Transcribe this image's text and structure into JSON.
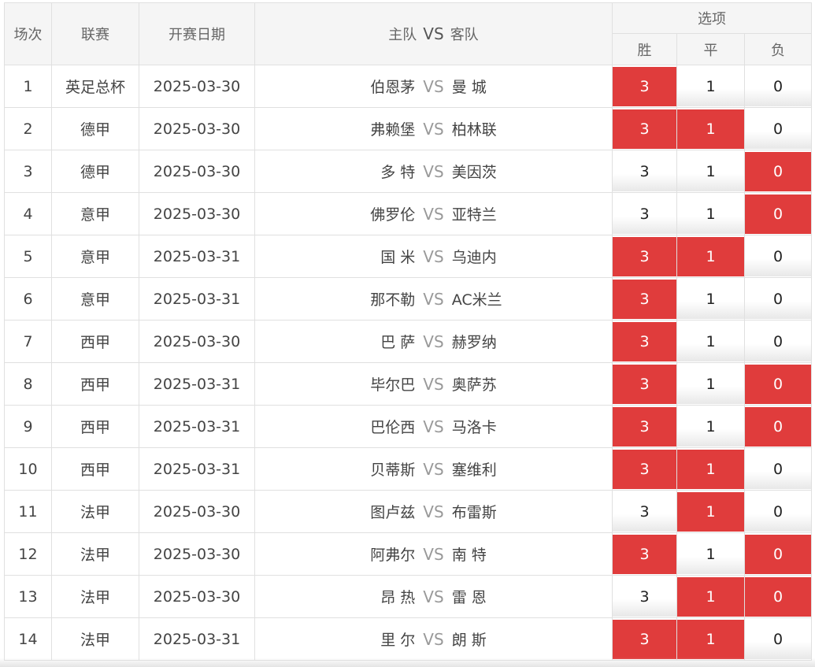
{
  "header": {
    "col_index": "场次",
    "col_league": "联赛",
    "col_date": "开赛日期",
    "col_home": "主队",
    "col_vs": "VS",
    "col_away": "客队",
    "col_options": "选项",
    "opt_win": "胜",
    "opt_draw": "平",
    "opt_lose": "负"
  },
  "vs_label": "VS",
  "option_labels": {
    "win": "3",
    "draw": "1",
    "lose": "0"
  },
  "colors": {
    "selected": "#e03c3c",
    "vs": "#999999",
    "border": "#e0e0e0"
  },
  "matches": [
    {
      "index": "1",
      "league": "英足总杯",
      "date": "2025-03-30",
      "home": "伯恩茅",
      "away": "曼 城",
      "win": true,
      "draw": false,
      "lose": false
    },
    {
      "index": "2",
      "league": "德甲",
      "date": "2025-03-30",
      "home": "弗赖堡",
      "away": "柏林联",
      "win": true,
      "draw": true,
      "lose": false
    },
    {
      "index": "3",
      "league": "德甲",
      "date": "2025-03-30",
      "home": "多 特",
      "away": "美因茨",
      "win": false,
      "draw": false,
      "lose": true
    },
    {
      "index": "4",
      "league": "意甲",
      "date": "2025-03-30",
      "home": "佛罗伦",
      "away": "亚特兰",
      "win": false,
      "draw": false,
      "lose": true
    },
    {
      "index": "5",
      "league": "意甲",
      "date": "2025-03-31",
      "home": "国 米",
      "away": "乌迪内",
      "win": true,
      "draw": true,
      "lose": false
    },
    {
      "index": "6",
      "league": "意甲",
      "date": "2025-03-31",
      "home": "那不勒",
      "away": "AC米兰",
      "win": true,
      "draw": false,
      "lose": false
    },
    {
      "index": "7",
      "league": "西甲",
      "date": "2025-03-30",
      "home": "巴 萨",
      "away": "赫罗纳",
      "win": true,
      "draw": false,
      "lose": false
    },
    {
      "index": "8",
      "league": "西甲",
      "date": "2025-03-31",
      "home": "毕尔巴",
      "away": "奥萨苏",
      "win": true,
      "draw": false,
      "lose": true
    },
    {
      "index": "9",
      "league": "西甲",
      "date": "2025-03-31",
      "home": "巴伦西",
      "away": "马洛卡",
      "win": true,
      "draw": false,
      "lose": true
    },
    {
      "index": "10",
      "league": "西甲",
      "date": "2025-03-31",
      "home": "贝蒂斯",
      "away": "塞维利",
      "win": true,
      "draw": true,
      "lose": false
    },
    {
      "index": "11",
      "league": "法甲",
      "date": "2025-03-30",
      "home": "图卢兹",
      "away": "布雷斯",
      "win": false,
      "draw": true,
      "lose": false
    },
    {
      "index": "12",
      "league": "法甲",
      "date": "2025-03-30",
      "home": "阿弗尔",
      "away": "南 特",
      "win": true,
      "draw": false,
      "lose": true
    },
    {
      "index": "13",
      "league": "法甲",
      "date": "2025-03-30",
      "home": "昂 热",
      "away": "雷 恩",
      "win": false,
      "draw": true,
      "lose": true
    },
    {
      "index": "14",
      "league": "法甲",
      "date": "2025-03-31",
      "home": "里 尔",
      "away": "朗 斯",
      "win": true,
      "draw": true,
      "lose": false
    }
  ]
}
